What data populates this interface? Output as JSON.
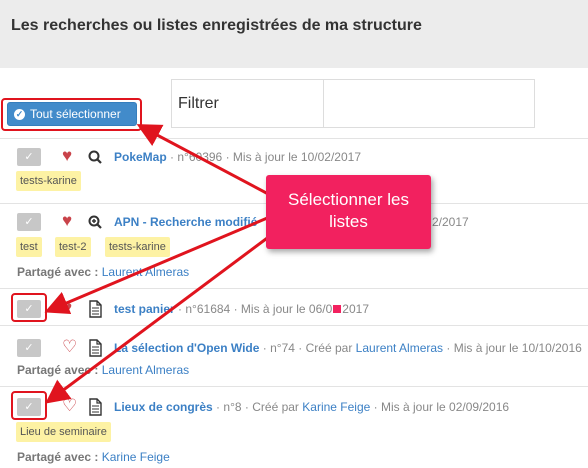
{
  "header": {
    "title": "Les recherches ou listes enregistrées de ma structure"
  },
  "filter": {
    "label": "Filtrer"
  },
  "select_all": {
    "label": "Tout sélectionner"
  },
  "rows": [
    {
      "title": "PokeMap",
      "number": "n°60396",
      "meta": "Mis à jour le 10/02/2017",
      "tags": [
        "tests-karine"
      ],
      "shared_label": "",
      "shared_with": ""
    },
    {
      "title": "APN - Recherche modifié",
      "number": "",
      "meta": "2/2017",
      "tags": [
        "test",
        "test-2",
        "tests-karine"
      ],
      "shared_label": "Partagé avec :",
      "shared_with": "Laurent Almeras"
    },
    {
      "title": "test panier",
      "number": "n°61684",
      "meta": "Mis à jour le 06/0",
      "meta_tail": "2017",
      "tags": [],
      "shared_label": "",
      "shared_with": ""
    },
    {
      "title": "La sélection d'Open Wide",
      "number": "n°74",
      "meta_prefix": "Créé par",
      "author": "Laurent Almeras",
      "meta": "Mis à jour le 10/10/2016",
      "tags": [],
      "shared_label": "Partagé avec :",
      "shared_with": "Laurent Almeras"
    },
    {
      "title": "Lieux de congrès",
      "number": "n°8",
      "meta_prefix": "Créé par",
      "author": "Karine Feige",
      "meta": "Mis à jour le 02/09/2016",
      "tags": [
        "Lieu de seminaire"
      ],
      "shared_label": "Partagé avec :",
      "shared_with": "Karine Feige"
    }
  ],
  "callout": {
    "line1": "Sélectionner les",
    "line2": "listes"
  },
  "colors": {
    "annotation_red": "#e0141e",
    "callout_pink": "#f2215f",
    "button_blue": "#428bca",
    "tag_yellow": "#fdf2a4",
    "link_blue": "#3c80c5"
  }
}
